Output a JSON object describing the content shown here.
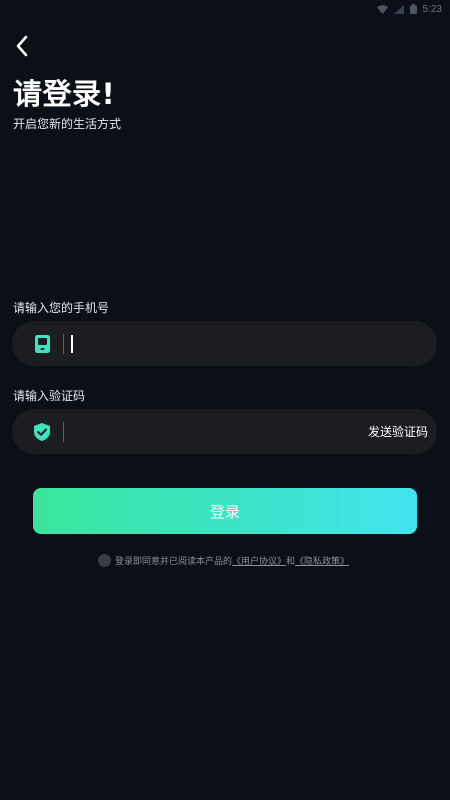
{
  "status_bar": {
    "time": "5:23"
  },
  "header": {
    "back_icon": "chevron-left-icon",
    "title": "请登录!",
    "subtitle": "开启您新的生活方式"
  },
  "phone": {
    "label": "请输入您的手机号",
    "icon": "phone-icon",
    "value": ""
  },
  "code": {
    "label": "请输入验证码",
    "icon": "shield-check-icon",
    "value": "",
    "send_label": "发送验证码"
  },
  "login": {
    "label": "登录"
  },
  "agreement": {
    "prefix": "登录即同意并已阅读本产品的",
    "user_agreement": "《用户协议》",
    "conjunction": "和",
    "privacy_policy": "《隐私政策》"
  },
  "colors": {
    "background": "#0b0f17",
    "field": "#1b1d21",
    "accent": "#3ee3c0",
    "gradient_start": "#39e59b",
    "gradient_end": "#43e3ee"
  }
}
